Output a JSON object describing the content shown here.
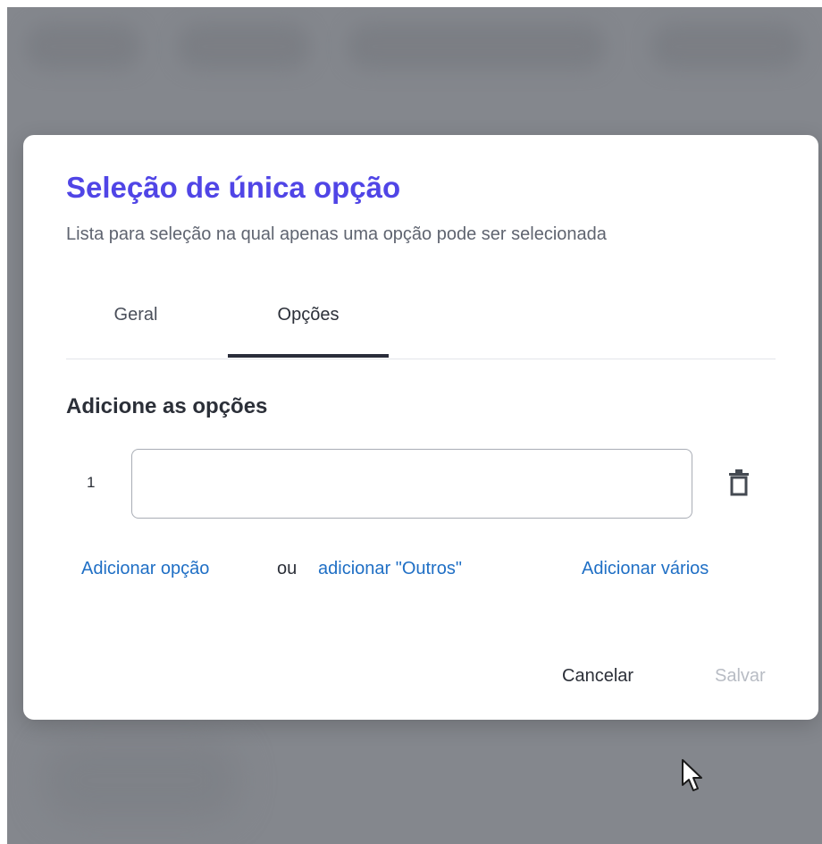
{
  "modal": {
    "title": "Seleção de única opção",
    "description": "Lista para seleção na qual apenas uma opção pode ser selecionada",
    "tabs": [
      {
        "label": "Geral",
        "active": false
      },
      {
        "label": "Opções",
        "active": true
      }
    ],
    "section_title": "Adicione as opções",
    "options": [
      {
        "number": "1",
        "value": "",
        "delete_icon": "trash-icon"
      }
    ],
    "links": {
      "add_option": "Adicionar opção",
      "or": "ou",
      "add_others": "adicionar \"Outros\"",
      "add_many": "Adicionar vários"
    },
    "actions": {
      "cancel": "Cancelar",
      "save": "Salvar"
    }
  },
  "colors": {
    "title": "#5045e6",
    "link": "#1f6fc5",
    "backdrop": "#84878d",
    "disabled": "#b8bcc4"
  }
}
